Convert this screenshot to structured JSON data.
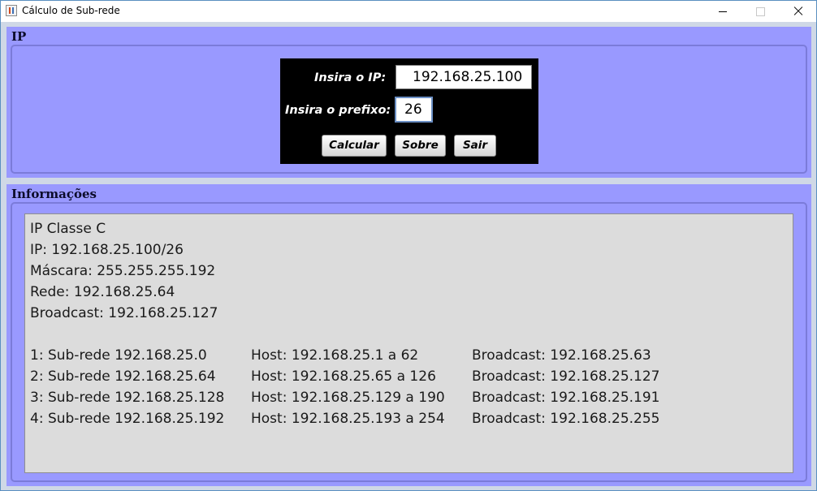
{
  "window": {
    "title": "Cálculo de Sub-rede",
    "min_glyph": "",
    "max_glyph": "",
    "close_glyph": ""
  },
  "ip_panel": {
    "title": "IP",
    "ip_label": "Insira o IP:",
    "ip_value": "192.168.25.100",
    "prefix_label": "Insira o prefixo:",
    "prefix_value": "26",
    "calc_button": "Calcular",
    "about_button": "Sobre",
    "exit_button": "Sair"
  },
  "info_panel": {
    "title": "Informações",
    "summary": [
      "IP Classe C",
      "IP: 192.168.25.100/26",
      "Máscara: 255.255.255.192",
      "Rede: 192.168.25.64",
      "Broadcast: 192.168.25.127"
    ],
    "subnets": [
      {
        "subnet": "1: Sub-rede 192.168.25.0",
        "host": "Host: 192.168.25.1 a 62",
        "broadcast": "Broadcast: 192.168.25.63"
      },
      {
        "subnet": "2: Sub-rede 192.168.25.64",
        "host": "Host: 192.168.25.65 a 126",
        "broadcast": "Broadcast: 192.168.25.127"
      },
      {
        "subnet": "3: Sub-rede 192.168.25.128",
        "host": "Host: 192.168.25.129 a 190",
        "broadcast": "Broadcast: 192.168.25.191"
      },
      {
        "subnet": "4: Sub-rede 192.168.25.192",
        "host": "Host: 192.168.25.193 a 254",
        "broadcast": "Broadcast: 192.168.25.255"
      }
    ]
  }
}
